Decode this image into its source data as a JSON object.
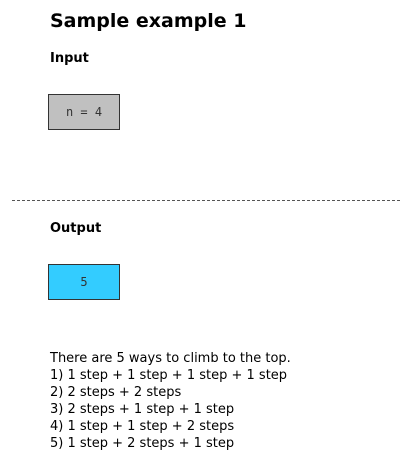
{
  "title": "Sample example 1",
  "input": {
    "heading": "Input",
    "value": "n = 4"
  },
  "output": {
    "heading": "Output",
    "value": "5"
  },
  "explanation": {
    "lines": [
      "There are 5 ways to climb to the top.",
      "1) 1 step + 1 step + 1 step + 1 step",
      "2) 2 steps + 2 steps",
      "3) 2 steps + 1 step + 1 step",
      "4) 1 step + 1 step + 2 steps",
      "5) 1 step + 2 steps + 1 step"
    ]
  },
  "colors": {
    "input_box_bg": "#c0c0c0",
    "output_box_bg": "#33ccff"
  }
}
